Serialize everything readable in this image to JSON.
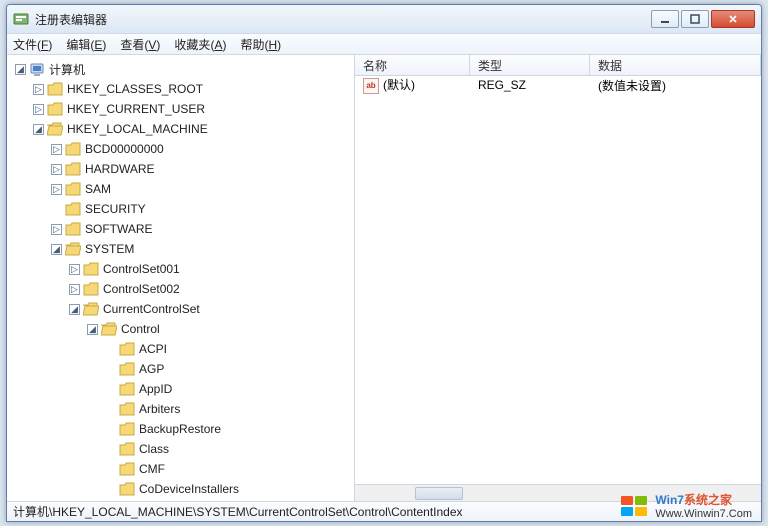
{
  "window": {
    "title": "注册表编辑器"
  },
  "menu": {
    "file": {
      "label": "文件",
      "accel": "F"
    },
    "edit": {
      "label": "编辑",
      "accel": "E"
    },
    "view": {
      "label": "查看",
      "accel": "V"
    },
    "fav": {
      "label": "收藏夹",
      "accel": "A"
    },
    "help": {
      "label": "帮助",
      "accel": "H"
    }
  },
  "tree": {
    "root": "计算机",
    "hkcr": "HKEY_CLASSES_ROOT",
    "hkcu": "HKEY_CURRENT_USER",
    "hklm": "HKEY_LOCAL_MACHINE",
    "hklm_children": {
      "bcd": "BCD00000000",
      "hardware": "HARDWARE",
      "sam": "SAM",
      "security": "SECURITY",
      "software": "SOFTWARE",
      "system": "SYSTEM"
    },
    "system_children": {
      "cs1": "ControlSet001",
      "cs2": "ControlSet002",
      "ccs": "CurrentControlSet"
    },
    "ccs_children": {
      "control": "Control"
    },
    "control_children": {
      "acpi": "ACPI",
      "agp": "AGP",
      "appid": "AppID",
      "arbiters": "Arbiters",
      "backuprestore": "BackupRestore",
      "class": "Class",
      "cmf": "CMF",
      "codeviceinstallers": "CoDeviceInstallers"
    }
  },
  "listview": {
    "headers": {
      "name": "名称",
      "type": "类型",
      "data": "数据"
    },
    "row": {
      "name": "(默认)",
      "type": "REG_SZ",
      "data": "(数值未设置)"
    },
    "col_widths": {
      "name": 115,
      "type": 120,
      "data": 160
    }
  },
  "statusbar": "计算机\\HKEY_LOCAL_MACHINE\\SYSTEM\\CurrentControlSet\\Control\\ContentIndex",
  "watermark": {
    "brand1": "Win7",
    "brand2": "系统之家",
    "url": "Www.Winwin7.Com"
  }
}
